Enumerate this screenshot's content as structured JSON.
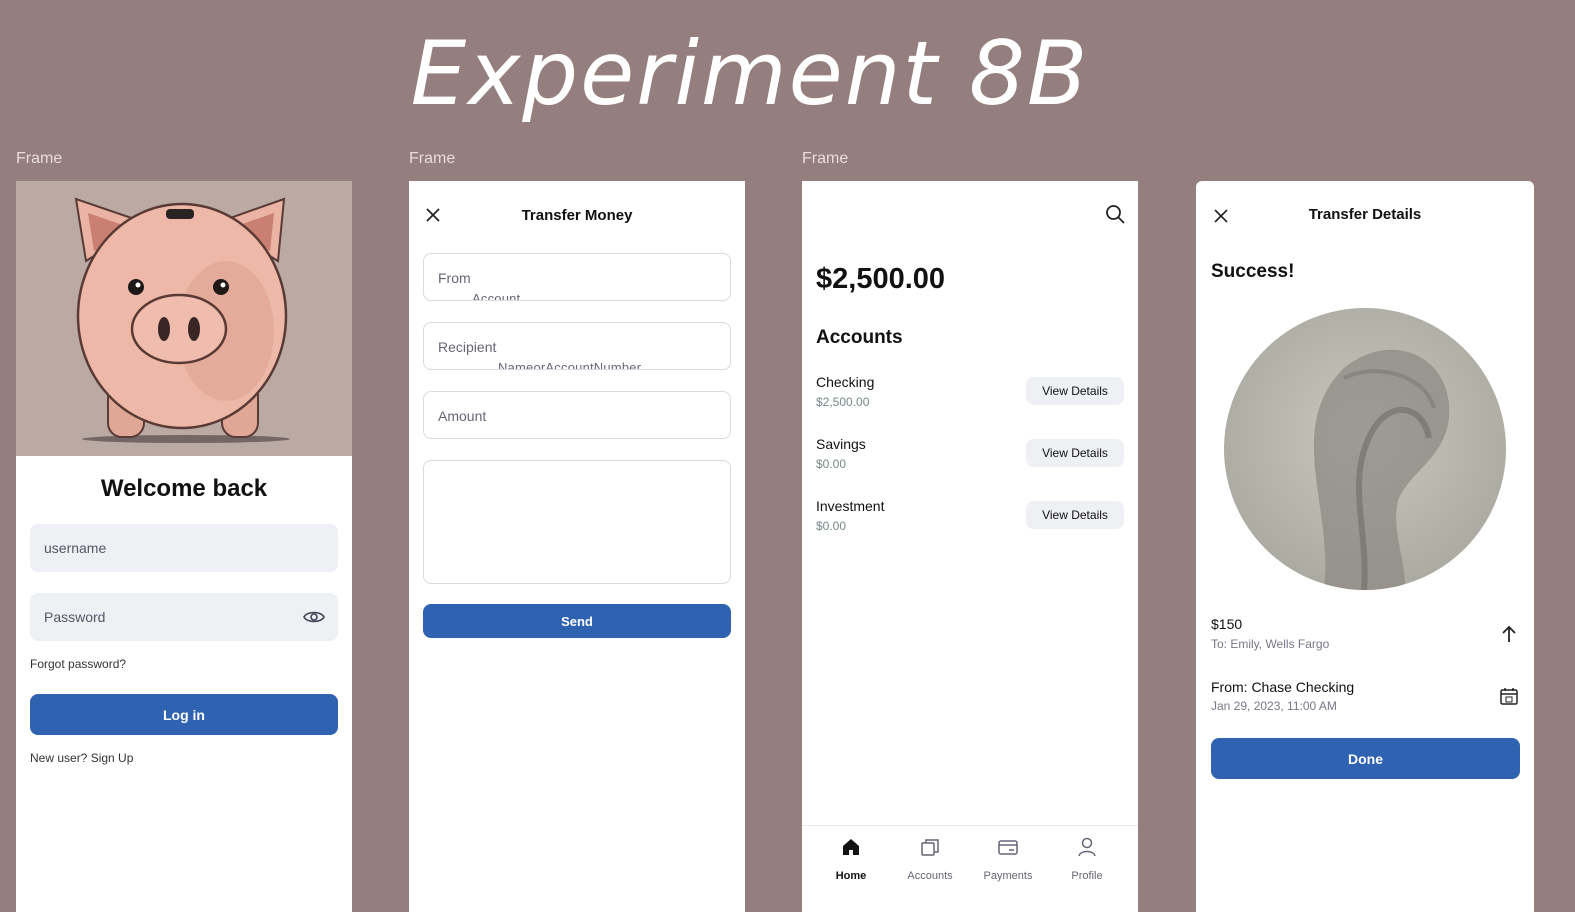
{
  "canvas": {
    "title": "Experiment 8B",
    "frame_label": "Frame"
  },
  "login": {
    "heading": "Welcome back",
    "username_placeholder": "username",
    "password_placeholder": "Password",
    "forgot": "Forgot password?",
    "login_button": "Log in",
    "signup": "New user? Sign Up"
  },
  "transfer": {
    "title": "Transfer Money",
    "from_label": "From",
    "from_sub": "Account",
    "recipient_label": "Recipient",
    "recipient_sub": "NameorAccountNumber",
    "amount_label": "Amount",
    "send_button": "Send"
  },
  "accounts": {
    "balance": "$2,500.00",
    "section_title": "Accounts",
    "items": [
      {
        "name": "Checking",
        "balance": "$2,500.00",
        "action": "View Details"
      },
      {
        "name": "Savings",
        "balance": "$0.00",
        "action": "View Details"
      },
      {
        "name": "Investment",
        "balance": "$0.00",
        "action": "View Details"
      }
    ],
    "tabs": [
      {
        "label": "Home",
        "icon": "home-icon",
        "active": true
      },
      {
        "label": "Accounts",
        "icon": "accounts-icon",
        "active": false
      },
      {
        "label": "Payments",
        "icon": "card-icon",
        "active": false
      },
      {
        "label": "Profile",
        "icon": "profile-icon",
        "active": false
      }
    ]
  },
  "details": {
    "title": "Transfer Details",
    "status": "Success!",
    "amount": "$150",
    "to": "To: Emily, Wells Fargo",
    "from": "From: Chase Checking",
    "date": "Jan 29, 2023, 11:00 AM",
    "done_button": "Done"
  },
  "colors": {
    "background": "#957f7e",
    "primary": "#2f63b2",
    "field": "#eef0f4"
  }
}
